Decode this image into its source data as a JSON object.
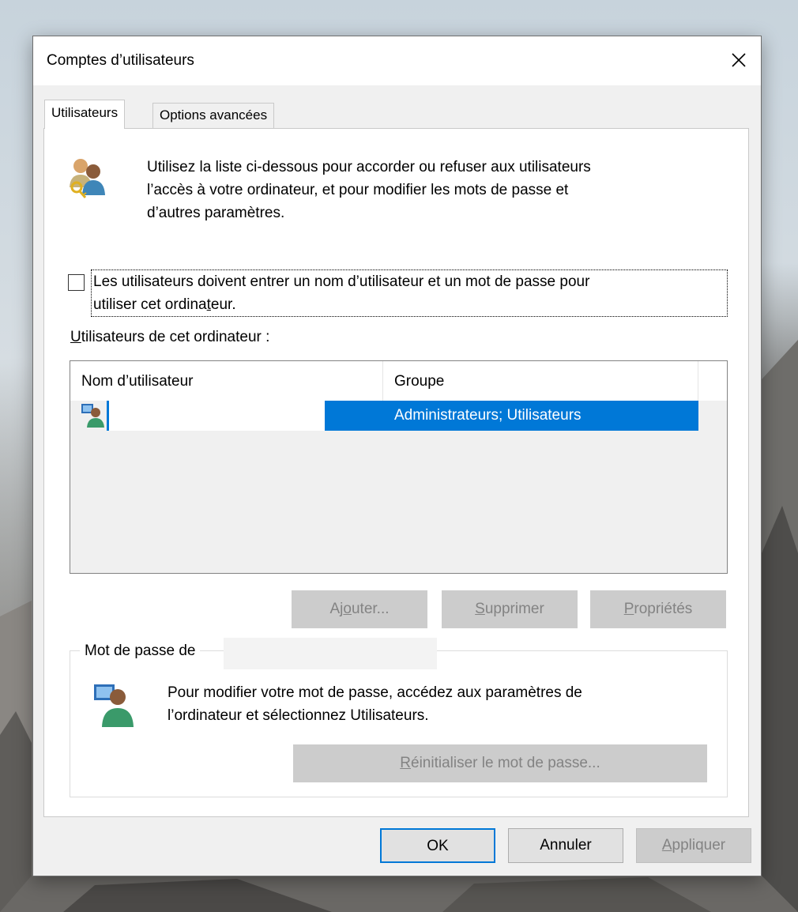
{
  "window": {
    "title": "Comptes d’utilisateurs",
    "close_glyph": "✕"
  },
  "tabs": [
    {
      "label": "Utilisateurs",
      "active": true
    },
    {
      "label": "Options avancées",
      "active": false
    }
  ],
  "users_tab": {
    "intro_line1": "Utilisez la liste ci-dessous pour accorder ou refuser aux utilisateurs",
    "intro_line2": "l’accès à votre ordinateur, et pour modifier les mots de passe et",
    "intro_line3": "d’autres paramètres.",
    "require_login_checkbox": {
      "checked": false,
      "label_line1": "Les utilisateurs doivent entrer un nom d’utilisateur et un mot de passe pour",
      "label_line2_pre": "utiliser cet ordina",
      "label_line2_accel": "t",
      "label_line2_post": "eur."
    },
    "users_heading_accel": "U",
    "users_heading_rest": "tilisateurs de cet ordinateur :",
    "list": {
      "columns": [
        "Nom d’utilisateur",
        "Groupe"
      ],
      "rows": [
        {
          "name": "",
          "group": "Administrateurs; Utilisateurs",
          "selected": true
        }
      ]
    },
    "buttons": {
      "add_pre": "Aj",
      "add_accel": "o",
      "add_post": "uter...",
      "delete_accel": "S",
      "delete_post": "upprimer",
      "props_accel": "P",
      "props_post": "ropriétés"
    },
    "password_group": {
      "legend": "Mot de passe de",
      "text_line1": "Pour modifier votre mot de passe, accédez aux paramètres de",
      "text_line2": "l’ordinateur et sélectionnez Utilisateurs.",
      "reset_accel": "R",
      "reset_post": "éinitialiser le mot de passe..."
    }
  },
  "footer": {
    "ok": "OK",
    "cancel": "Annuler",
    "apply_accel": "A",
    "apply_post": "ppliquer"
  },
  "colors": {
    "accent": "#0078d7",
    "disabled_button": "#cccccc",
    "disabled_text": "#838383"
  },
  "icons": [
    "close-icon",
    "users-key-icon",
    "user-row-icon",
    "user-computer-icon"
  ]
}
